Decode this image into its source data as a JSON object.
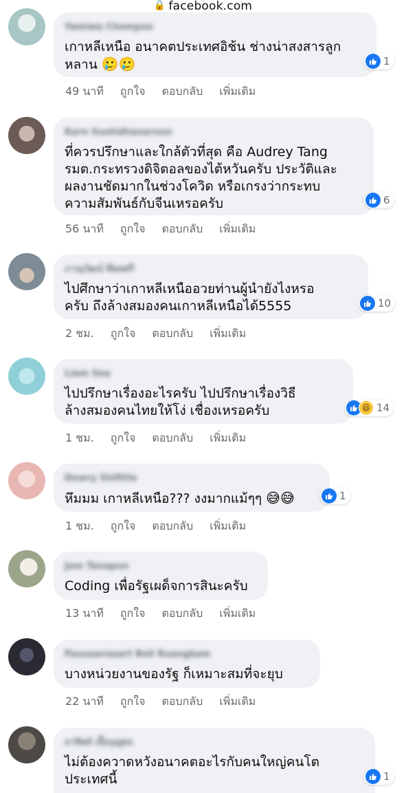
{
  "browser": {
    "url": "facebook.com",
    "lock_icon": "lock-icon"
  },
  "actions_labels": {
    "like": "ถูกใจ",
    "reply": "ตอบกลับ",
    "more": "เพิ่มเติม"
  },
  "comments": [
    {
      "author": "Yamiwa Chompoo",
      "text": "เกาหลีเหนือ อนาคตประเทศอิช้น ช่างน่าสงสารลูก\nหลาน",
      "emoji": "🥲🥲",
      "time": "49 นาที",
      "reaction_count": "1",
      "reactions": [
        "like"
      ],
      "avatar_color": "#a7c6c4"
    },
    {
      "author": "Karn Suntidhanaroon",
      "text": "ที่ควรปรึกษาและใกล้ตัวที่สุด คือ Audrey Tang\nรมต.กระทรวงดิจิตอลของไต้หวันครับ ประวัติและ\nผลงานชัดมากในช่วงโควิด หรือเกรงว่ากระทบ\nความสัมพันธ์กับจีนเหรอครับ",
      "emoji": "",
      "time": "56 นาที",
      "reaction_count": "6",
      "reactions": [
        "like"
      ],
      "avatar_color": "#6b5a55"
    },
    {
      "author": "ภาณุวัฒน์ ทีพลศรี",
      "text": "ไปศึกษาว่าเกาหลีเหนืออวยท่านผู้นำยังไงหรอ\nครับ ถึงล้างสมองคนเกาหลีเหนือได้5555",
      "emoji": "",
      "time": "2 ชม.",
      "reaction_count": "10",
      "reactions": [
        "like"
      ],
      "avatar_color": "#7d8c95"
    },
    {
      "author": "Liam Sea",
      "text": "ไปปรึกษาเรื่องอะไรครับ ไปปรึกษาเรื่องวิธี\nล้างสมองคนไทยให้โง่ เชื่องเหรอครับ",
      "emoji": "",
      "time": "1 ชม.",
      "reaction_count": "14",
      "reactions": [
        "like",
        "haha"
      ],
      "avatar_color": "#8fd0d8"
    },
    {
      "author": "Dowry Shifttle",
      "text": "หึมมม เกาหลีเหนือ??? งงมากแม้ๆๆ",
      "emoji": "😅😅",
      "time": "1 ชม.",
      "reaction_count": "1",
      "reactions": [
        "like"
      ],
      "avatar_color": "#e8b7b3"
    },
    {
      "author": "Jom Tanapon",
      "text": "Coding เพื่อรัฐเผด็จการสินะครับ",
      "emoji": "",
      "time": "13 นาที",
      "reaction_count": "",
      "reactions": [],
      "avatar_color": "#9aa58a"
    },
    {
      "author": "Passawrasart Bell Ruangkam",
      "text": "บางหน่วยงานของรัฐ ก็เหมาะสมที่จะยุบ",
      "emoji": "",
      "time": "22 นาที",
      "reaction_count": "",
      "reactions": [],
      "avatar_color": "#2a2a33"
    },
    {
      "author": "อาทิตย์ เอื้อบุญผล",
      "text": "ไม่ต้องควาดหวังอนาคตอะไรกับคนใหญ่คนโต\nประเทศนี้",
      "emoji": "",
      "time": "",
      "reaction_count": "1",
      "reactions": [
        "like"
      ],
      "avatar_color": "#4d4a46"
    }
  ]
}
